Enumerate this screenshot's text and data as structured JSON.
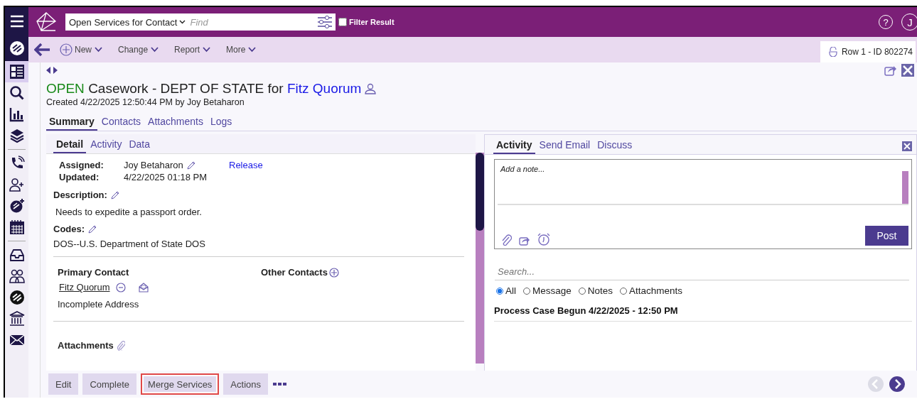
{
  "header": {
    "search": {
      "scope": "Open Services for Contact",
      "placeholder": "Find"
    },
    "filter_result": {
      "label": "Filter Result",
      "checked": false
    },
    "help": "?",
    "avatar": "J"
  },
  "toolbar": {
    "menus": [
      "New",
      "Change",
      "Report",
      "More"
    ],
    "record_tab": "Row 1 - ID 802274"
  },
  "case": {
    "status": "OPEN",
    "title": "Casework - DEPT OF STATE for",
    "contact": "Fitz Quorum",
    "created": "Created 4/22/2025 12:50:44 PM by Joy Betaharon",
    "tabs": [
      {
        "label": "Summary",
        "selected": true
      },
      {
        "label": "Contacts",
        "selected": false
      },
      {
        "label": "Attachments",
        "selected": false
      },
      {
        "label": "Logs",
        "selected": false
      }
    ]
  },
  "detail": {
    "tabs": [
      {
        "label": "Detail",
        "selected": true
      },
      {
        "label": "Activity",
        "selected": false
      },
      {
        "label": "Data",
        "selected": false
      }
    ],
    "assigned_label": "Assigned:",
    "assigned": "Joy Betaharon",
    "release": "Release",
    "updated_label": "Updated:",
    "updated": "4/22/2025 01:18 PM",
    "description_label": "Description:",
    "description": "Needs to expedite a passport order.",
    "codes_label": "Codes:",
    "codes": "DOS--U.S. Department of State DOS",
    "primary_contact_label": "Primary Contact",
    "primary_contact": "Fitz Quorum",
    "address": "Incomplete Address",
    "other_contacts_label": "Other Contacts",
    "attachments_label": "Attachments"
  },
  "actions": [
    {
      "label": "Edit",
      "highlighted": false
    },
    {
      "label": "Complete",
      "highlighted": false
    },
    {
      "label": "Merge Services",
      "highlighted": true
    },
    {
      "label": "Actions",
      "highlighted": false
    }
  ],
  "activity": {
    "tabs": [
      {
        "label": "Activity",
        "selected": true
      },
      {
        "label": "Send Email",
        "selected": false
      },
      {
        "label": "Discuss",
        "selected": false
      }
    ],
    "note": {
      "placeholder": "Add a note..."
    },
    "post": "Post",
    "search": {
      "placeholder": "Search..."
    },
    "filters": [
      {
        "label": "All",
        "selected": true
      },
      {
        "label": "Message",
        "selected": false
      },
      {
        "label": "Notes",
        "selected": false
      },
      {
        "label": "Attachments",
        "selected": false
      }
    ],
    "entries": [
      "Process Case Begun 4/22/2025 - 12:50 PM"
    ]
  }
}
